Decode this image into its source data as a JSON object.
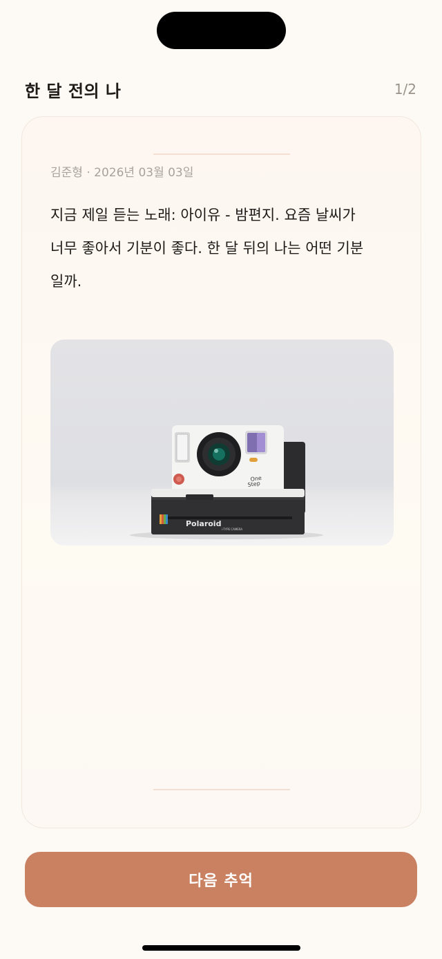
{
  "header": {
    "title": "한 달 전의 나",
    "page_indicator": "1/2"
  },
  "memory": {
    "author_date": "김준형 · 2026년 03월 03일",
    "text_line_1": "지금 제일 듣는 노래: 아이유 - 밤편지. 요즘 날씨가",
    "text_line_2": "너무 좋아서 기분이 좋다. 한 달 뒤의 나는 어떤 기분",
    "text_line_3": "일까.",
    "photo": {
      "description_icon": "camera-photo",
      "brand": "Polaroid",
      "model": "One Step 2",
      "subtext": "i-TYPE CAMERA"
    }
  },
  "next_button": {
    "label": "다음 추억"
  },
  "colors": {
    "accent": "#c98162",
    "background": "#fdf9f4",
    "meta_text": "#a8a29c"
  }
}
